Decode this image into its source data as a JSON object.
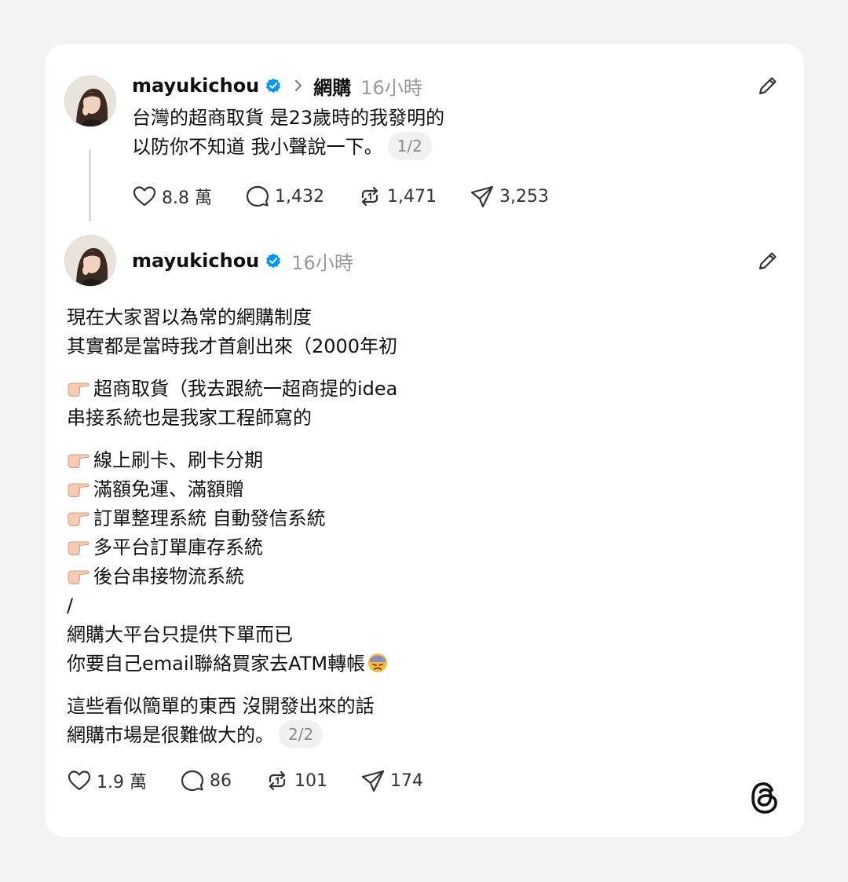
{
  "post1": {
    "username": "mayukichou",
    "topic": "網購",
    "time": "16小時",
    "lines": [
      "台灣的超商取貨 是23歲時的我發明的",
      "以防你不知道 我小聲說一下。"
    ],
    "page_badge": "1/2",
    "likes": "8.8 萬",
    "comments": "1,432",
    "reposts": "1,471",
    "shares": "3,253"
  },
  "post2": {
    "username": "mayukichou",
    "time": "16小時",
    "p1": [
      "現在大家習以為常的網購制度",
      "其實都是當時我才首創出來（2000年初"
    ],
    "p2_first": "超商取貨（我去跟統一超商提的idea",
    "p2_second": "串接系統也是我家工程師寫的",
    "bullets": [
      "線上刷卡、刷卡分期",
      "滿額免運、滿額贈",
      "訂單整理系統 自動發信系統",
      "多平台訂單庫存系統",
      "後台串接物流系統"
    ],
    "slash": "/",
    "p3": [
      "網購大平台只提供下單而已",
      "你要自己email聯絡買家去ATM轉帳"
    ],
    "p4": [
      "這些看似簡單的東西 沒開發出來的話",
      "網購市場是很難做大的。"
    ],
    "page_badge": "2/2",
    "likes": "1.9 萬",
    "comments": "86",
    "reposts": "101",
    "shares": "174"
  },
  "colors": {
    "verified": "#0095f6",
    "muted": "#999999"
  },
  "icons": [
    "verified-icon",
    "chevron-right-icon",
    "edit-icon",
    "heart-icon",
    "comment-icon",
    "repost-icon",
    "share-icon",
    "pointing-hand-emoji",
    "sweat-face-emoji",
    "threads-logo"
  ]
}
